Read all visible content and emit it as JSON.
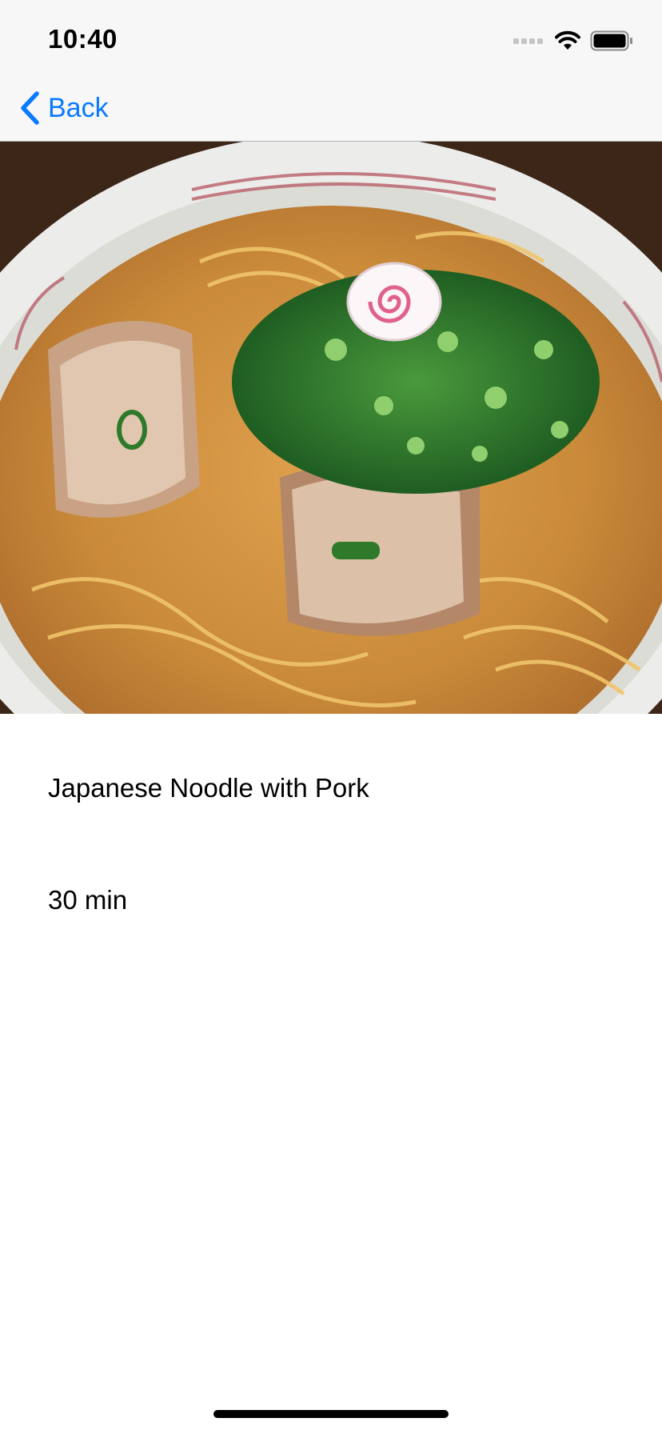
{
  "status_bar": {
    "time": "10:40",
    "icons": [
      "cellular-signal-icon",
      "wifi-icon",
      "battery-icon"
    ]
  },
  "nav": {
    "back_label": "Back",
    "back_icon": "chevron-left-icon"
  },
  "colors": {
    "accent": "#0a7aff",
    "bar_background": "#f7f7f7"
  },
  "recipe": {
    "name": "Japanese Noodle with Pork",
    "time": "30 min"
  }
}
